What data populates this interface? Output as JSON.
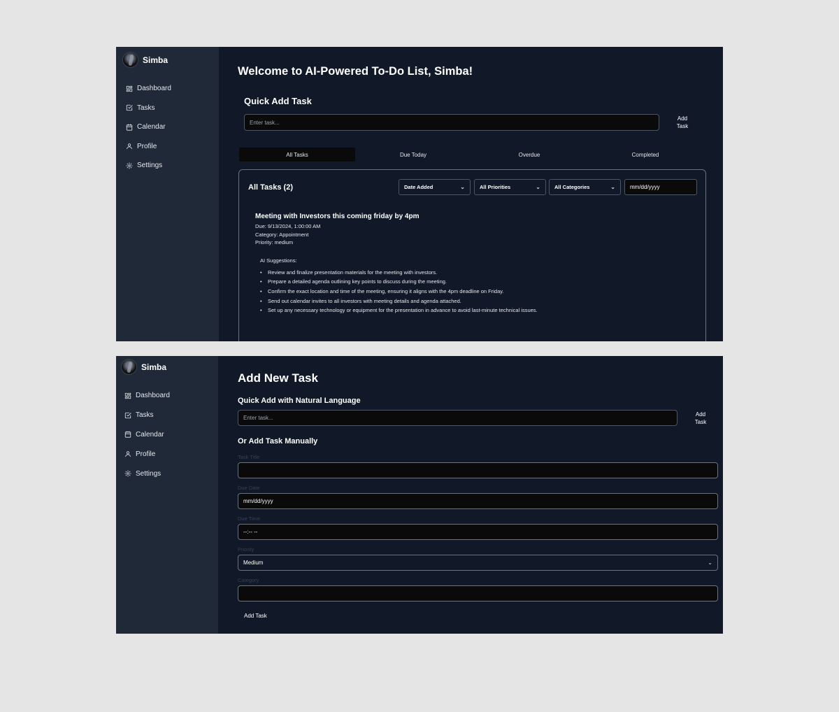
{
  "user": {
    "name": "Simba"
  },
  "nav": [
    {
      "label": "Dashboard",
      "icon": "grid-icon"
    },
    {
      "label": "Tasks",
      "icon": "checkbox-icon"
    },
    {
      "label": "Calendar",
      "icon": "calendar-icon"
    },
    {
      "label": "Profile",
      "icon": "user-icon"
    },
    {
      "label": "Settings",
      "icon": "gear-icon"
    }
  ],
  "dashboard": {
    "title": "Welcome to AI-Powered To-Do List, Simba!",
    "quick_add_title": "Quick Add Task",
    "quick_add_placeholder": "Enter task...",
    "add_btn_line1": "Add",
    "add_btn_line2": "Task",
    "tabs": [
      "All Tasks",
      "Due Today",
      "Overdue",
      "Completed"
    ],
    "active_tab": "All Tasks",
    "list_title": "All Tasks (2)",
    "filters": {
      "sort": "Date Added",
      "priority": "All Priorities",
      "category": "All Categories",
      "date": "mm/dd/yyyy"
    },
    "task": {
      "title": "Meeting with Investors this coming friday by 4pm",
      "due": "Due: 9/13/2024, 1:00:00 AM",
      "category": "Category: Appointment",
      "priority": "Priority: medium",
      "ai_label": "AI Suggestions:",
      "suggestions": [
        "Review and finalize presentation materials for the meeting with investors.",
        "Prepare a detailed agenda outlining key points to discuss during the meeting.",
        "Confirm the exact location and time of the meeting, ensuring it aligns with the 4pm deadline on Friday.",
        "Send out calendar invites to all investors with meeting details and agenda attached.",
        "Set up any necessary technology or equipment for the presentation in advance to avoid last-minute technical issues."
      ]
    }
  },
  "add_task": {
    "title": "Add New Task",
    "nl_title": "Quick Add with Natural Language",
    "nl_placeholder": "Enter task...",
    "add_btn_line1": "Add",
    "add_btn_line2": "Task",
    "manual_title": "Or Add Task Manually",
    "labels": {
      "title": "Task Title",
      "due_date": "Due Date",
      "due_time": "Due Time",
      "priority": "Priority",
      "category": "Category"
    },
    "values": {
      "title": "",
      "due_date": "mm/dd/yyyy",
      "due_time": "--:-- --",
      "priority": "Medium",
      "category": ""
    },
    "submit": "Add Task"
  },
  "colors": {
    "bg": "#111827",
    "sidebar": "#1f2937",
    "input_bg": "#0a0a0a",
    "border": "#4b5563"
  }
}
